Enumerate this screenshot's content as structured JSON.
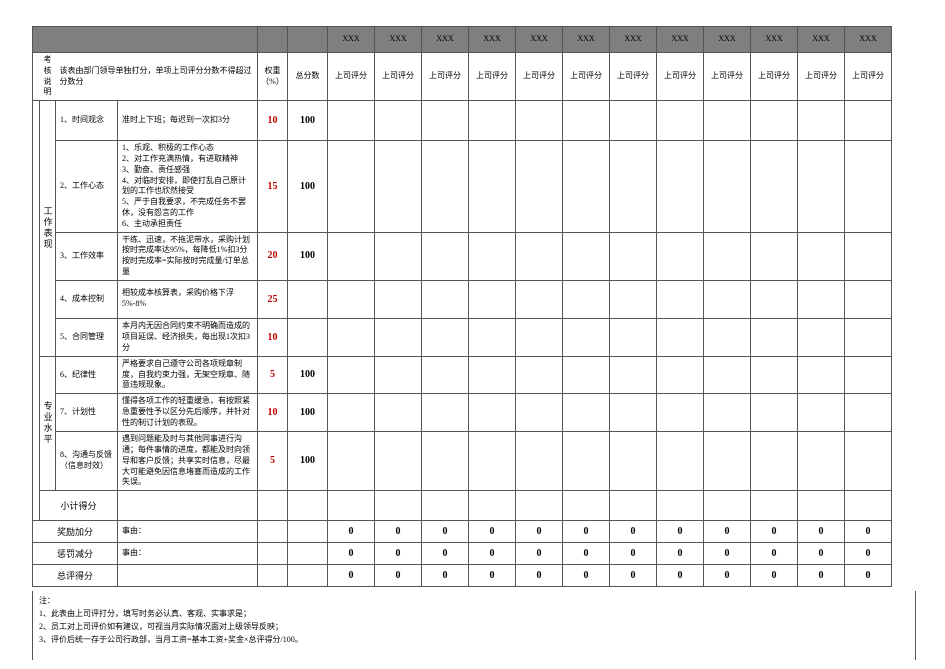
{
  "header": {
    "rater_names": [
      "XXX",
      "XXX",
      "XXX",
      "XXX",
      "XXX",
      "XXX",
      "XXX",
      "XXX",
      "XXX",
      "XXX",
      "XXX",
      "XXX"
    ],
    "desc_label": "考核说明",
    "desc_text": "该表由部门领导单独打分，单项上司评分分数不得超过分数分",
    "weight_label": "权重（%）",
    "total_label": "总分数",
    "rater_label": "上司评分"
  },
  "categories": [
    {
      "name": "工作表现",
      "items": [
        {
          "no": "1、时间观念",
          "desc": "准时上下班；每迟到一次扣3分",
          "weight": "10",
          "total": "100"
        },
        {
          "no": "2、工作心态",
          "desc": "1、乐观、积极的工作心态\n2、对工作充满热情，有进取精神\n3、勤奋、责任感强\n4、对临时安排，即使打乱自己原计划的工作也欣然接受\n5、严于自我要求，不完成任务不罢休，没有怨言的工作\n6、主动承担责任",
          "weight": "15",
          "total": "100"
        },
        {
          "no": "3、工作效率",
          "desc": "干练、迅速，不拖泥带水，采购计划按时完成率达95%，每降低1%扣3分\n按时完成率=实际按时完成量/订单总量",
          "weight": "20",
          "total": "100"
        },
        {
          "no": "4、成本控制",
          "desc": "相较成本核算表，采购价格下浮5%-8%",
          "weight": "25",
          "total": ""
        },
        {
          "no": "5、合同管理",
          "desc": "本月内无因合同约束不明确而造成的项目延误、经济损失，每出现1次扣3分",
          "weight": "10",
          "total": ""
        }
      ]
    },
    {
      "name": "专业水平",
      "items": [
        {
          "no": "6、纪律性",
          "desc": "严格要求自己遵守公司各项规章制度，自我约束力强，无架空规章、随意违规现象。",
          "weight": "5",
          "total": "100"
        },
        {
          "no": "7、计划性",
          "desc": "懂得各项工作的轻重缓急，有按照紧急重要性予以区分先后顺序，并针对性的制订计划的表现。",
          "weight": "10",
          "total": "100"
        },
        {
          "no": "8、沟通与反馈（信息时效）",
          "desc": "遇到问题能及时与其他同事进行沟通；每件事情的进度，都能及时向领导和客户反馈；共享实时信息，尽最大可能避免因信息堵塞而造成的工作失误。",
          "weight": "5",
          "total": "100"
        }
      ]
    }
  ],
  "subtotal_label": "小计得分",
  "summary": [
    {
      "label": "奖励加分",
      "reason_label": "事由：",
      "values": [
        "0",
        "0",
        "0",
        "0",
        "0",
        "0",
        "0",
        "0",
        "0",
        "0",
        "0",
        "0"
      ]
    },
    {
      "label": "惩罚减分",
      "reason_label": "事由：",
      "values": [
        "0",
        "0",
        "0",
        "0",
        "0",
        "0",
        "0",
        "0",
        "0",
        "0",
        "0",
        "0"
      ]
    },
    {
      "label": "总评得分",
      "reason_label": "",
      "values": [
        "0",
        "0",
        "0",
        "0",
        "0",
        "0",
        "0",
        "0",
        "0",
        "0",
        "0",
        "0"
      ]
    }
  ],
  "notes": {
    "title": "注：",
    "lines": [
      "1、此表由上司评打分，填写时务必认真、客观、实事求是；",
      "2、员工对上司评价如有建议，可视当月实际情况面对上级领导反映；",
      "3、评价后统一存于公司行政部，当月工资=基本工资+奖金×总评得分/100。"
    ]
  }
}
